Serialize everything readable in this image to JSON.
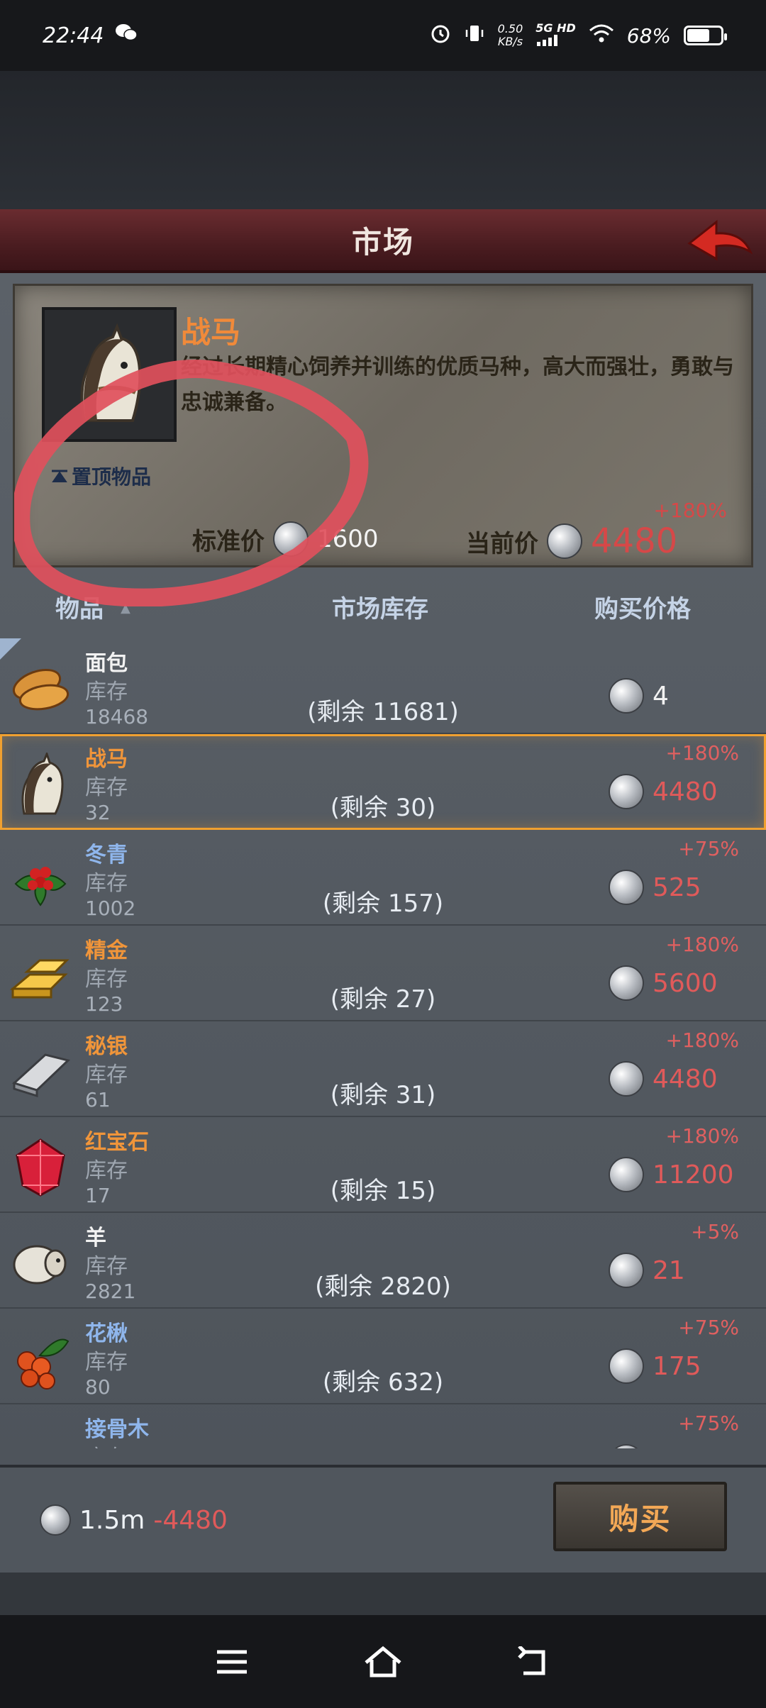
{
  "status_bar": {
    "time": "22:44",
    "net_speed_value": "0.50",
    "net_speed_unit": "KB/s",
    "network_label": "5G HD",
    "battery_percent": "68%",
    "battery_level": 0.68
  },
  "header": {
    "title": "市场"
  },
  "detail": {
    "name": "战马",
    "description": "经过长期精心饲养并训练的优质马种，高大而强壮，勇敢与忠诚兼备。",
    "pin_label": "置顶物品",
    "standard_price_label": "标准价",
    "standard_price": "1600",
    "current_price_label": "当前价",
    "current_price": "4480",
    "current_change": "+180%"
  },
  "columns": {
    "item": "物品",
    "market_stock": "市场库存",
    "buy_price": "购买价格"
  },
  "inventory_label": "库存",
  "items": [
    {
      "name": "面包",
      "inventory": "18468",
      "remaining": "(剩余 11681)",
      "change": "",
      "price": "4",
      "name_color": "#f2f2f2",
      "price_color": "#f2f2f2",
      "icon": "bread-icon",
      "selected": false
    },
    {
      "name": "战马",
      "inventory": "32",
      "remaining": "(剩余 30)",
      "change": "+180%",
      "price": "4480",
      "name_color": "#f0953a",
      "price_color": "#e05a5a",
      "icon": "horse-icon",
      "selected": true
    },
    {
      "name": "冬青",
      "inventory": "1002",
      "remaining": "(剩余 157)",
      "change": "+75%",
      "price": "525",
      "name_color": "#8fb6ec",
      "price_color": "#e05a5a",
      "icon": "holly-icon",
      "selected": false
    },
    {
      "name": "精金",
      "inventory": "123",
      "remaining": "(剩余 27)",
      "change": "+180%",
      "price": "5600",
      "name_color": "#f0953a",
      "price_color": "#e05a5a",
      "icon": "gold-bar-icon",
      "selected": false
    },
    {
      "name": "秘银",
      "inventory": "61",
      "remaining": "(剩余 31)",
      "change": "+180%",
      "price": "4480",
      "name_color": "#f0953a",
      "price_color": "#e05a5a",
      "icon": "silver-bar-icon",
      "selected": false
    },
    {
      "name": "红宝石",
      "inventory": "17",
      "remaining": "(剩余 15)",
      "change": "+180%",
      "price": "11200",
      "name_color": "#f0953a",
      "price_color": "#e05a5a",
      "icon": "ruby-icon",
      "selected": false
    },
    {
      "name": "羊",
      "inventory": "2821",
      "remaining": "(剩余 2820)",
      "change": "+5%",
      "price": "21",
      "name_color": "#f2f2f2",
      "price_color": "#e05a5a",
      "icon": "sheep-icon",
      "selected": false
    },
    {
      "name": "花楸",
      "inventory": "80",
      "remaining": "(剩余 632)",
      "change": "+75%",
      "price": "175",
      "name_color": "#8fb6ec",
      "price_color": "#e05a5a",
      "icon": "rowan-berry-icon",
      "selected": false
    },
    {
      "name": "接骨木",
      "inventory": "",
      "remaining": "",
      "change": "+75%",
      "price": "280",
      "name_color": "#8fb6ec",
      "price_color": "#e05a5a",
      "icon": "elder-flower-icon",
      "selected": false
    }
  ],
  "footer": {
    "money": "1.5m",
    "delta": "-4480",
    "buy_label": "购买"
  },
  "colors": {
    "accent_orange": "#f0953a",
    "price_red": "#e05a5a",
    "rare_blue": "#8fb6ec",
    "title_banner": "#5a2428"
  }
}
